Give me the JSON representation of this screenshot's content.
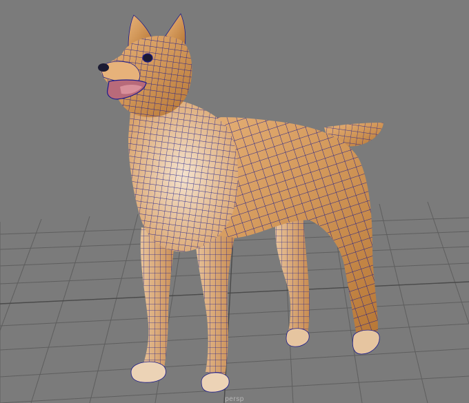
{
  "viewport": {
    "camera_label": "persp",
    "background_color": "#7b7b7b",
    "grid_color": "#5a5a5a",
    "model": {
      "icon": "dog-mesh-icon",
      "fill_color": "#d49a5c",
      "light_color": "#f2ddc5",
      "shadow_color": "#8a5424",
      "wireframe_color": "#1a1a8c"
    }
  }
}
